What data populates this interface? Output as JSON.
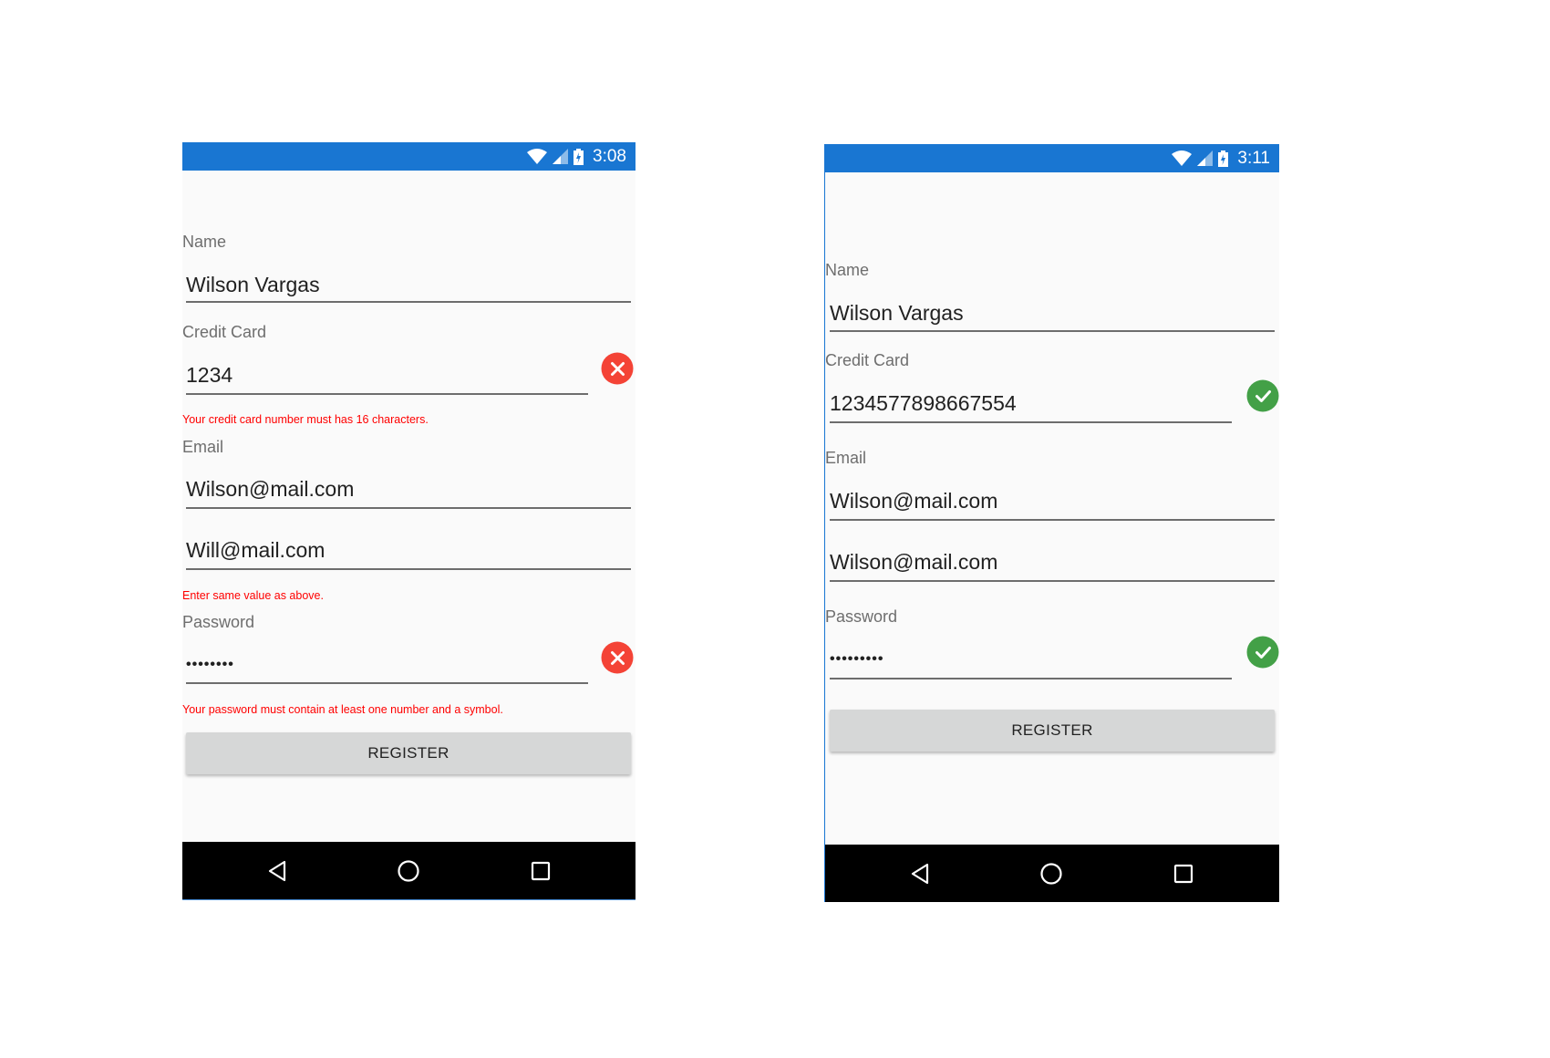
{
  "colors": {
    "status_bar": "#1976d2",
    "error_text": "#ff0000",
    "error_badge": "#f44336",
    "success_badge": "#43a047",
    "button_bg": "#d6d7d7",
    "nav_bar": "#000000"
  },
  "phones": [
    {
      "status": {
        "time": "3:08",
        "icons": [
          "wifi-icon",
          "signal-icon",
          "battery-charging-icon"
        ]
      },
      "form": {
        "name_label": "Name",
        "name_value": "Wilson Vargas",
        "credit_card_label": "Credit Card",
        "credit_card_value": "1234",
        "credit_card_status": "invalid",
        "credit_card_error": "Your credit card number must has 16 characters.",
        "email_label": "Email",
        "email_value": "Wilson@mail.com",
        "email_confirm_value": "Will@mail.com",
        "email_confirm_error": "Enter same value as above.",
        "password_label": "Password",
        "password_value": "••••••••",
        "password_status": "invalid",
        "password_error": "Your password must contain at least one number and a symbol.",
        "register_label": "REGISTER"
      },
      "nav": [
        "back-icon",
        "home-icon",
        "recents-icon"
      ]
    },
    {
      "status": {
        "time": "3:11",
        "icons": [
          "wifi-icon",
          "signal-icon",
          "battery-charging-icon"
        ]
      },
      "form": {
        "name_label": "Name",
        "name_value": "Wilson Vargas",
        "credit_card_label": "Credit Card",
        "credit_card_value": "1234577898667554",
        "credit_card_status": "valid",
        "email_label": "Email",
        "email_value": "Wilson@mail.com",
        "email_confirm_value": "Wilson@mail.com",
        "password_label": "Password",
        "password_value": "•••••••••",
        "password_status": "valid",
        "register_label": "REGISTER"
      },
      "nav": [
        "back-icon",
        "home-icon",
        "recents-icon"
      ]
    }
  ]
}
